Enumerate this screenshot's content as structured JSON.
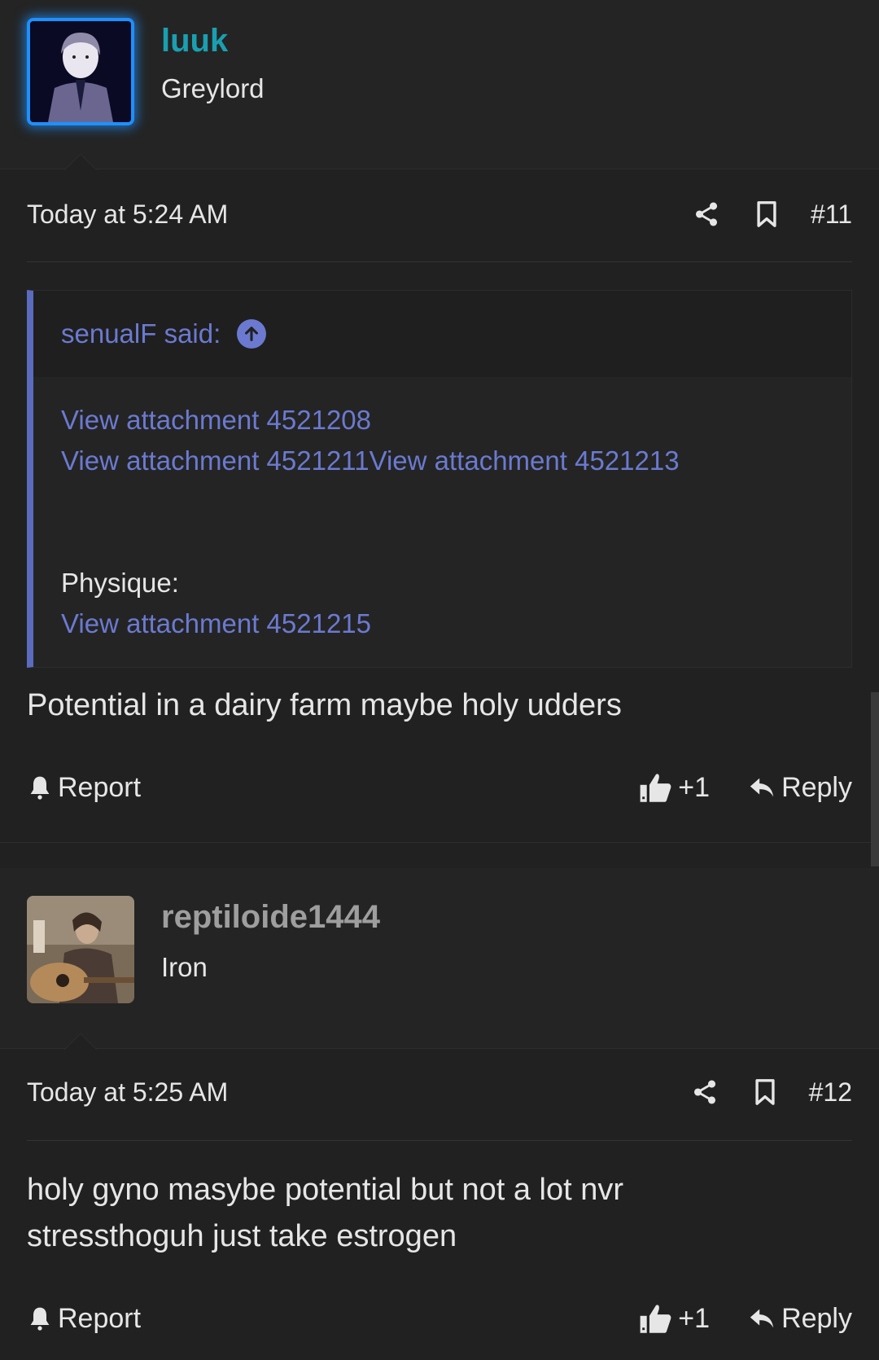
{
  "posts": [
    {
      "user": {
        "name": "luuk",
        "title": "Greylord",
        "name_color": "#1a9fb0",
        "avatar_glow": "#1e90ff"
      },
      "time": "Today at 5:24 AM",
      "number": "#11",
      "quote": {
        "author": "senualF said:",
        "line1": "View attachment 4521208",
        "line2a": "View attachment 4521211",
        "line2b": "View attachment 4521213",
        "label": "Physique:",
        "line3": "View attachment 4521215",
        "accent": "#5b6bc0"
      },
      "text": "Potential in a dairy farm maybe holy udders",
      "report_label": "Report",
      "like_label": "+1",
      "reply_label": "Reply"
    },
    {
      "user": {
        "name": "reptiloide1444",
        "title": "Iron",
        "name_color": "#9e9e9e"
      },
      "time": "Today at 5:25 AM",
      "number": "#12",
      "text_line1": "holy gyno masybe potential but not a lot nvr",
      "text_line2": "stressthoguh just take estrogen",
      "report_label": "Report",
      "like_label": "+1",
      "reply_label": "Reply"
    }
  ],
  "icons": [
    "share-icon",
    "bookmark-icon",
    "bell-icon",
    "thumbs-up-icon",
    "reply-icon",
    "arrow-up-circle-icon"
  ]
}
